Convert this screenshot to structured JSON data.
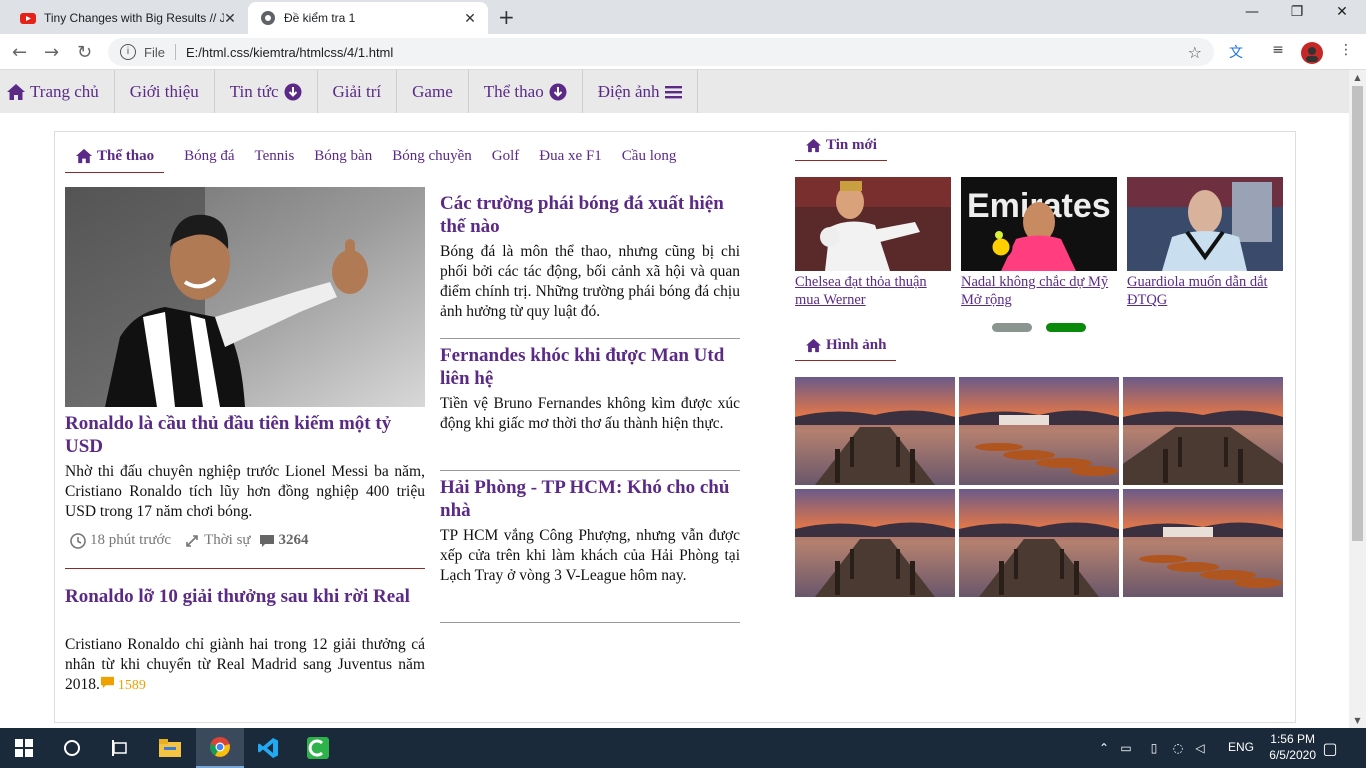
{
  "browser": {
    "tabs": [
      {
        "title": "Tiny Changes with Big Results // J",
        "icon": "youtube-icon"
      },
      {
        "title": "Đề kiểm tra 1",
        "icon": "globe-icon"
      }
    ],
    "url_scheme": "File",
    "url": "E:/html.css/kiemtra/htmlcss/4/1.html"
  },
  "menu": [
    {
      "label": "Trang chủ",
      "icon": "home-icon"
    },
    {
      "label": "Giới thiệu"
    },
    {
      "label": "Tin tức",
      "icon": "arrow-down-circle-icon"
    },
    {
      "label": "Giải trí"
    },
    {
      "label": "Game"
    },
    {
      "label": "Thể thao",
      "icon": "arrow-down-circle-icon"
    },
    {
      "label": "Điện ảnh",
      "icon": "bars-icon"
    }
  ],
  "subnav": {
    "active": "Thể thao",
    "items": [
      "Bóng đá",
      "Tennis",
      "Bóng bàn",
      "Bóng chuyền",
      "Golf",
      "Đua xe F1",
      "Cầu long"
    ]
  },
  "featured": {
    "title": "Ronaldo là cầu thủ đầu tiên kiếm một tỷ USD",
    "desc": "Nhờ thi đấu chuyên nghiệp trước Lionel Messi ba năm, Cristiano Ronaldo tích lũy hơn đồng nghiệp 400 triệu USD trong 17 năm chơi bóng.",
    "time": "18 phút trước",
    "category": "Thời sự",
    "comments": "3264"
  },
  "featured2": {
    "title": "Ronaldo lỡ 10 giải thưởng sau khi rời Real",
    "desc": "Cristiano Ronaldo chỉ giành hai trong 12 giải thưởng cá nhân từ khi chuyển từ Real Madrid sang Juventus năm 2018.",
    "comments": "1589"
  },
  "side_articles": [
    {
      "title": "Các trường phái bóng đá xuất hiện thế nào",
      "desc": "Bóng đá là môn thể thao, nhưng cũng bị chi phối bởi các tác động, bối cảnh xã hội và quan điểm chính trị. Những trường phái bóng đá chịu ảnh hưởng từ quy luật đó."
    },
    {
      "title": "Fernandes khóc khi được Man Utd liên hệ",
      "desc": "Tiền vệ Bruno Fernandes không kìm được xúc động khi giấc mơ thời thơ ấu thành hiện thực."
    },
    {
      "title": "Hải Phòng - TP HCM: Khó cho chủ nhà",
      "desc": "TP HCM vắng Công Phượng, nhưng vẫn được xếp cửa trên khi làm khách của Hải Phòng tại Lạch Tray ở vòng 3 V-League hôm nay."
    }
  ],
  "news": {
    "heading": "Tin mới",
    "items": [
      {
        "caption": "Chelsea đạt thỏa thuận mua Werner"
      },
      {
        "caption": "Nadal không chắc dự Mỹ Mở rộng"
      },
      {
        "caption": "Guardiola muốn dẫn dắt ĐTQG"
      }
    ],
    "slider_active_index": 1
  },
  "gallery": {
    "heading": "Hình ảnh",
    "count": 6
  },
  "taskbar": {
    "lang": "ENG",
    "time": "1:56 PM",
    "date": "6/5/2020"
  },
  "colors": {
    "accent": "#5b2a86",
    "rule": "#8b2a2a",
    "menu_bg": "#e9e9e9",
    "dot_active": "#0a8a0a",
    "dot_inactive": "#8a9590",
    "comment": "#f0a000"
  }
}
